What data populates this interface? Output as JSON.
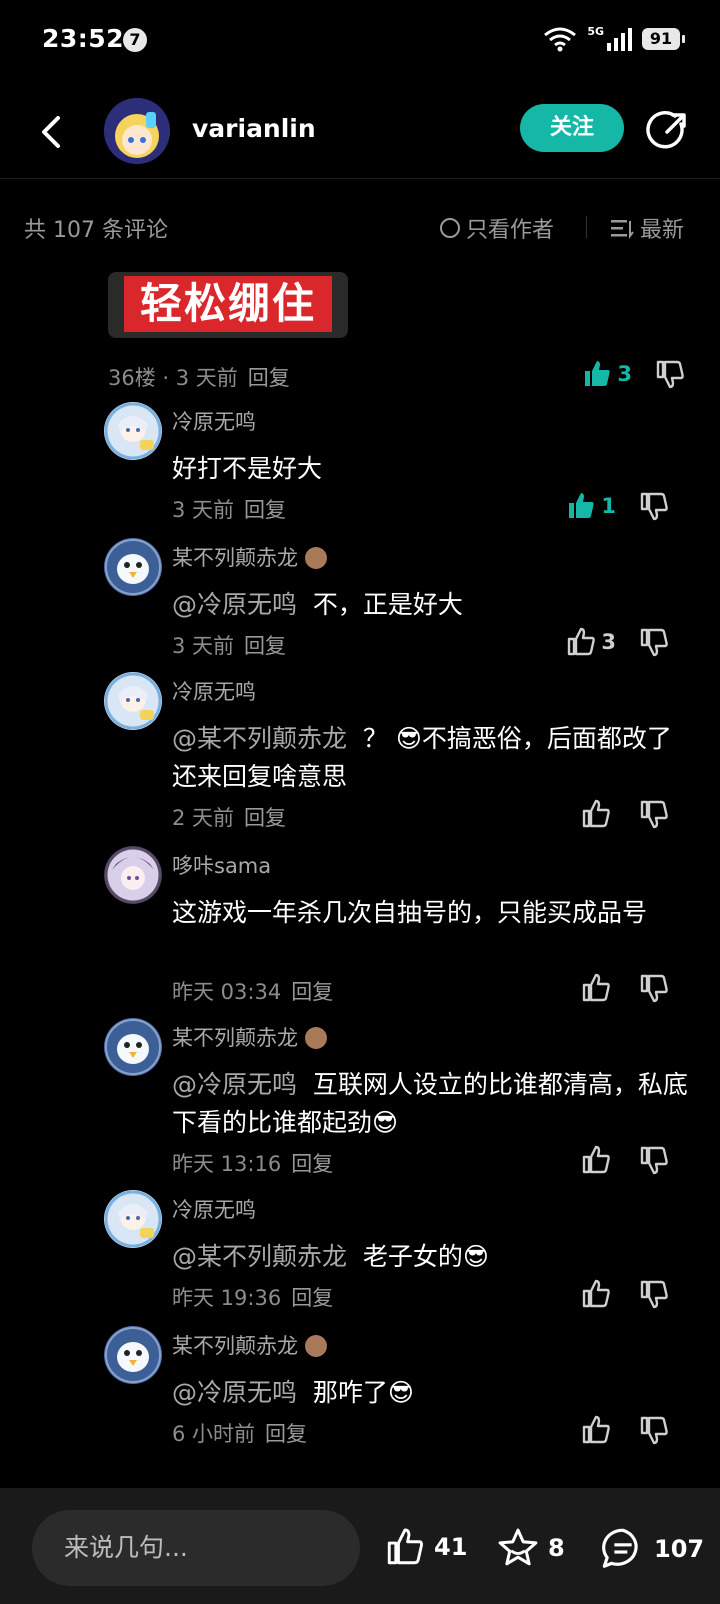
{
  "status_bar": {
    "time": "23:52",
    "notification_count": "7",
    "network": "5G",
    "battery": "91"
  },
  "header": {
    "username": "varianlin",
    "follow_label": "关注"
  },
  "filter_bar": {
    "comment_count": "共 107 条评论",
    "author_only": "只看作者",
    "sort": "最新"
  },
  "colors": {
    "accent": "#15b8a6",
    "background": "#000000",
    "muted_text": "#8c8c8c"
  },
  "main_comment": {
    "image_text": "轻松绷住",
    "meta": "36楼 · 3 天前",
    "reply_label": "回复",
    "likes": "3",
    "liked": true
  },
  "replies": [
    {
      "name": "冷原无鸣",
      "mention": "",
      "text": "好打不是好大",
      "time": "3 天前",
      "reply": "回复",
      "likes": "1",
      "liked": true,
      "avatar": "anime-girl"
    },
    {
      "name": "某不列颠赤龙",
      "mention": "@冷原无鸣",
      "text": "不，正是好大",
      "time": "3 天前",
      "reply": "回复",
      "likes": "3",
      "liked": false,
      "avatar": "penguin"
    },
    {
      "name": "冷原无鸣",
      "mention": "@某不列颠赤龙",
      "text": "？ 😎不搞恶俗，后面都改了还来回复啥意思",
      "time": "2 天前",
      "reply": "回复",
      "likes": "",
      "liked": false,
      "avatar": "anime-girl"
    },
    {
      "name": "哆咔sama",
      "mention": "",
      "text": "这游戏一年杀几次自抽号的，只能买成品号",
      "time": "昨天 03:34",
      "reply": "回复",
      "likes": "",
      "liked": false,
      "avatar": "purple-girl"
    },
    {
      "name": "某不列颠赤龙",
      "mention": "@冷原无鸣",
      "text": "互联网人设立的比谁都清高，私底下看的比谁都起劲😎",
      "time": "昨天 13:16",
      "reply": "回复",
      "likes": "",
      "liked": false,
      "avatar": "penguin"
    },
    {
      "name": "冷原无鸣",
      "mention": "@某不列颠赤龙",
      "text": "老子女的😎",
      "time": "昨天 19:36",
      "reply": "回复",
      "likes": "",
      "liked": false,
      "avatar": "anime-girl"
    },
    {
      "name": "某不列颠赤龙",
      "mention": "@冷原无鸣",
      "text": "那咋了😎",
      "time": "6 小时前",
      "reply": "回复",
      "likes": "",
      "liked": false,
      "avatar": "penguin"
    }
  ],
  "bottom_bar": {
    "input_placeholder": "来说几句...",
    "likes": "41",
    "favorites": "8",
    "comments": "107"
  }
}
